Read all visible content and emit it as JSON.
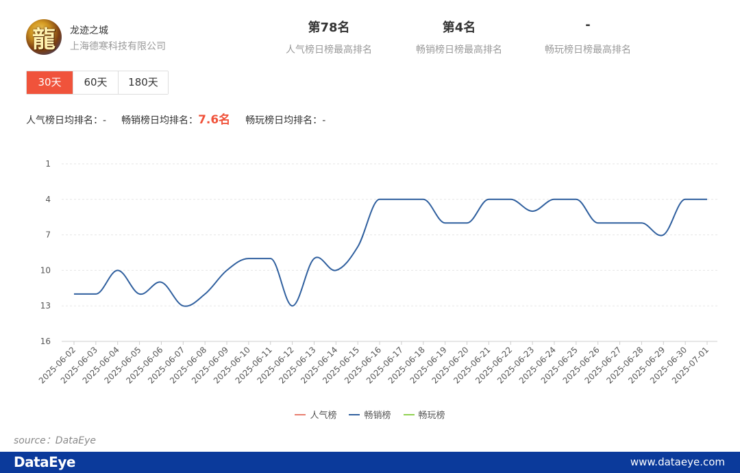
{
  "app": {
    "name": "龙迹之城",
    "company": "上海德寒科技有限公司",
    "icon": "dragon-character-icon"
  },
  "stats": [
    {
      "rank": "第78名",
      "label": "人气榜日榜最高排名"
    },
    {
      "rank": "第4名",
      "label": "畅销榜日榜最高排名"
    },
    {
      "rank": "-",
      "label": "畅玩榜日榜最高排名"
    }
  ],
  "tabs": [
    {
      "label": "30天",
      "active": true
    },
    {
      "label": "60天",
      "active": false
    },
    {
      "label": "180天",
      "active": false
    }
  ],
  "averages": {
    "popularity_label": "人气榜日均排名：",
    "popularity_value": "-",
    "sales_label": "畅销榜日均排名：",
    "sales_value": "7.6名",
    "play_label": "畅玩榜日均排名：",
    "play_value": "-"
  },
  "colors": {
    "accent": "#f0533b",
    "popularity": "#e87c6e",
    "sales": "#2f5f9e",
    "play": "#8fd14f",
    "footer": "#0b3a9b"
  },
  "chart_data": {
    "type": "line",
    "x": [
      "2025-06-02",
      "2025-06-03",
      "2025-06-04",
      "2025-06-05",
      "2025-06-06",
      "2025-06-07",
      "2025-06-08",
      "2025-06-09",
      "2025-06-10",
      "2025-06-11",
      "2025-06-12",
      "2025-06-13",
      "2025-06-14",
      "2025-06-15",
      "2025-06-16",
      "2025-06-17",
      "2025-06-18",
      "2025-06-19",
      "2025-06-20",
      "2025-06-21",
      "2025-06-22",
      "2025-06-23",
      "2025-06-24",
      "2025-06-25",
      "2025-06-26",
      "2025-06-27",
      "2025-06-28",
      "2025-06-29",
      "2025-06-30",
      "2025-07-01"
    ],
    "series": [
      {
        "name": "人气榜",
        "values": []
      },
      {
        "name": "畅销榜",
        "values": [
          12,
          12,
          10,
          12,
          11,
          13,
          12,
          10,
          9,
          9,
          13,
          9,
          10,
          8,
          4,
          4,
          4,
          6,
          6,
          4,
          4,
          5,
          4,
          4,
          6,
          6,
          6,
          7,
          4,
          4
        ]
      },
      {
        "name": "畅玩榜",
        "values": []
      }
    ],
    "yticks": [
      1,
      4,
      7,
      10,
      13,
      16
    ],
    "ylim": [
      1,
      16
    ],
    "y_inverted": true,
    "grid": true,
    "legend_position": "bottom"
  },
  "source": "source：DataEye",
  "footer": {
    "brand": "DataEye",
    "url": "www.dataeye.com"
  }
}
